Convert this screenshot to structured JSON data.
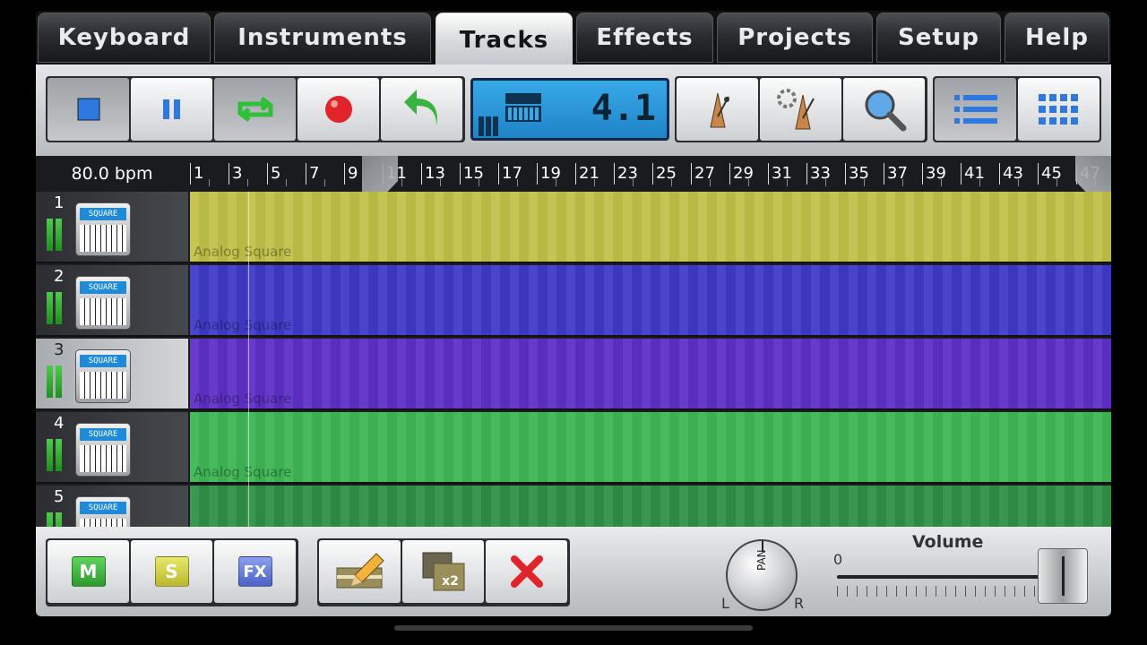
{
  "tabs": [
    {
      "label": "Keyboard",
      "active": false
    },
    {
      "label": "Instruments",
      "active": false
    },
    {
      "label": "Tracks",
      "active": true
    },
    {
      "label": "Effects",
      "active": false
    },
    {
      "label": "Projects",
      "active": false
    },
    {
      "label": "Setup",
      "active": false
    },
    {
      "label": "Help",
      "active": false
    }
  ],
  "toolbar": {
    "transport": [
      {
        "icon": "stop-icon"
      },
      {
        "icon": "pause-icon"
      },
      {
        "icon": "loop-icon"
      },
      {
        "icon": "record-icon"
      },
      {
        "icon": "undo-icon"
      }
    ],
    "display": {
      "position": "4.1",
      "icon": "synth-icon"
    },
    "tools": [
      {
        "icon": "metronome-icon"
      },
      {
        "icon": "metronome-settings-icon"
      },
      {
        "icon": "search-icon"
      }
    ],
    "views": [
      {
        "icon": "list-view-icon"
      },
      {
        "icon": "grid-view-icon"
      }
    ]
  },
  "ruler": {
    "bpm": "80.0 bpm",
    "marks": [
      "1",
      "3",
      "5",
      "7",
      "9",
      "11",
      "13",
      "15",
      "17",
      "19",
      "21",
      "23",
      "25",
      "27",
      "29",
      "31",
      "33",
      "35",
      "37",
      "39",
      "41",
      "43",
      "45",
      "47"
    ]
  },
  "tracks": [
    {
      "number": "1",
      "instrument_badge": "SQUARE",
      "name": "Analog Square",
      "color": "#bfc048",
      "selected": false
    },
    {
      "number": "2",
      "instrument_badge": "SQUARE",
      "name": "Analog Square",
      "color": "#3f39c8",
      "selected": false
    },
    {
      "number": "3",
      "instrument_badge": "SQUARE",
      "name": "Analog Square",
      "color": "#5e2fc7",
      "selected": true
    },
    {
      "number": "4",
      "instrument_badge": "SQUARE",
      "name": "Analog Square",
      "color": "#3db654",
      "selected": false
    },
    {
      "number": "5",
      "instrument_badge": "SQUARE",
      "name": "",
      "color": "#2f8f45",
      "selected": false
    }
  ],
  "bottom": {
    "mute_label": "M",
    "solo_label": "S",
    "fx_label": "FX",
    "edit_icon": "pencil-edit-icon",
    "duplicate_label": "x2",
    "delete_icon": "delete-x-icon",
    "pan_label": "PAN",
    "pan_left": "L",
    "pan_right": "R",
    "volume_label": "Volume",
    "volume_min": "0",
    "volume_level": 0.94
  }
}
